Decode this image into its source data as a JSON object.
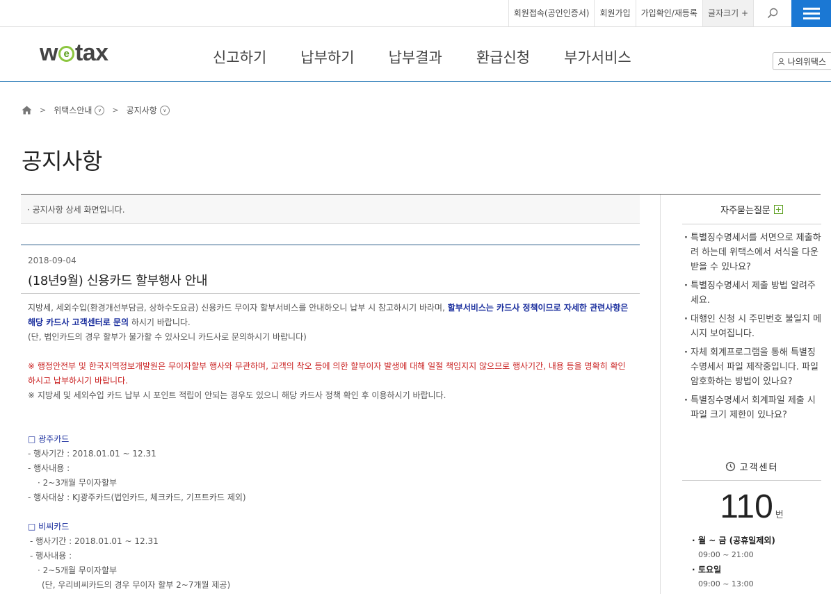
{
  "utility": {
    "items": [
      "회원접속(공인인증서)",
      "회원가입",
      "가입확인/재등록",
      "글자크기 +"
    ]
  },
  "header": {
    "logo_left": "w",
    "logo_e": "e",
    "logo_right": "tax",
    "nav": [
      "신고하기",
      "납부하기",
      "납부결과",
      "환급신청",
      "부가서비스"
    ],
    "my_wetax": "나의위택스"
  },
  "breadcrumb": {
    "items": [
      "위택스안내",
      "공지사항"
    ]
  },
  "page_title": "공지사항",
  "info_text": "· 공지사항 상세 화면입니다.",
  "article": {
    "date": "2018-09-04",
    "title": "(18년9월) 신용카드 할부행사 안내",
    "p1_normal": "지방세, 세외수입(환경개선부담금, 상하수도요금) 신용카드 무이자 할부서비스를 안내하오니 납부 시 참고하시기 바라며, ",
    "p1_blue": "할부서비스는 카드사 정책이므로 자세한 관련사항은 해당 카드사 고객센터로 문의",
    "p1_end": " 하시기 바랍니다.",
    "p2": " (단, 법인카드의 경우 할부가 불가할 수 있사오니 카드사로 문의하시기 바랍니다)",
    "warn": "※ 행정안전부 및 한국지역정보개발원은 무이자할부 행사와 무관하며, 고객의 착오 등에 의한 할부이자 발생에 대해 일절 책임지지 않으므로 행사기간, 내용 등을 명확히 확인하시고 납부하시기 바랍니다.",
    "note": "※ 지방세 및 세외수입 카드 납부 시 포인트 적립이 안되는 경우도 있으니 해당 카드사 정책 확인 후 이용하시기 바랍니다.",
    "card1": {
      "name": "□ 광주카드",
      "period": " - 행사기간 : 2018.01.01 ~ 12.31",
      "content_label": " - 행사내용 :",
      "content": "   · 2~3개월 무이자할부",
      "target": " - 행사대상 : KJ광주카드(법인카드, 체크카드, 기프트카드 제외)"
    },
    "card2": {
      "name": "□ 비씨카드",
      "period": "  - 행사기간 : 2018.01.01 ~ 12.31",
      "content_label": "  - 행사내용 :",
      "content": "    · 2~5개월 무이자할부",
      "extra": "     (단, 우리비씨카드의 경우 무이자 할부 2~7개월 제공)"
    }
  },
  "sidebar": {
    "faq_title": "자주묻는질문",
    "faq_plus": "+",
    "faq": [
      "특별징수명세서를 서면으로 제출하려 하는데 위택스에서 서식을 다운받을 수 있나요?",
      "특별징수명세서 제출 방법 알려주세요.",
      "대행인 신청 시 주민번호 불일치 메시지 보여집니다.",
      "자체 회계프로그램을 통해 특별징수명세서 파일 제작중입니다. 파일 암호화하는 방법이 있나요?",
      "특별징수명세서 회계파일 제출 시 파일 크기 제한이 있나요?"
    ],
    "cs_title": "고객센터",
    "cs_number": "110",
    "cs_unit": "번",
    "hours": [
      {
        "label": "월 ~ 금 (공휴일제외)",
        "time": "09:00 ~ 21:00"
      },
      {
        "label": "토요일",
        "time": "09:00 ~ 13:00"
      }
    ]
  },
  "colors": {
    "menu_blue": "#1b78d4",
    "link_navy": "#1b2f9e",
    "warning_red": "#c91f1f",
    "logo_green": "#8cc63f"
  },
  "icons": [
    "search-icon",
    "hamburger-menu-icon",
    "home-icon",
    "chevron-right-icon",
    "chevron-down-circle-icon",
    "user-icon",
    "plus-box-icon",
    "clock-icon"
  ]
}
